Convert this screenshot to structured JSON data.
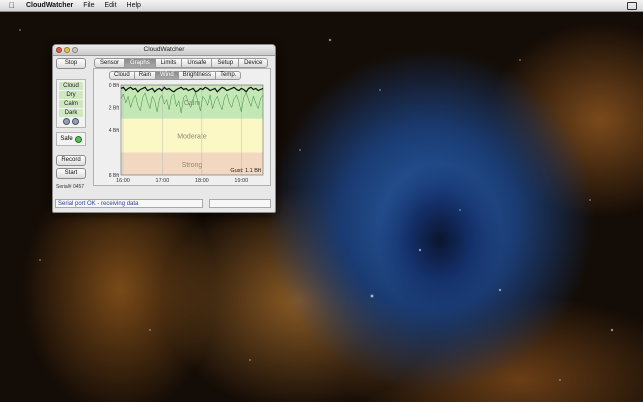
{
  "menubar": {
    "app_name": "CloudWatcher",
    "items": [
      "File",
      "Edit",
      "Help"
    ]
  },
  "window": {
    "title": "CloudWatcher"
  },
  "controls": {
    "stop_label": "Stop",
    "status_items": [
      "Cloud",
      "Dry",
      "Calm",
      "Dark"
    ],
    "safe_label": "Safe",
    "record_label": "Record",
    "start_label": "Start",
    "serial": "Serial# 0457"
  },
  "tabs": {
    "items": [
      "Sensor",
      "Graphs",
      "Limits",
      "Unsafe",
      "Setup",
      "Device"
    ],
    "active": "Graphs"
  },
  "subtabs": {
    "items": [
      "Cloud",
      "Rain",
      "Wind",
      "Brightness",
      "Temp."
    ],
    "active": "Wind"
  },
  "status_message": "Serial port OK - receiving data",
  "chart_data": {
    "type": "line",
    "zones": [
      {
        "name": "Calm",
        "from": 0,
        "to": 3,
        "color": "#c3e8b6"
      },
      {
        "name": "Moderate",
        "from": 3,
        "to": 6,
        "color": "#fbf8c6"
      },
      {
        "name": "Strong",
        "from": 6,
        "to": 8,
        "color": "#f2d8c0"
      }
    ],
    "y_ticks": [
      "0 Bft",
      "2 Bft",
      "4 Bft",
      "8 Bft"
    ],
    "y_tick_values": [
      0,
      2,
      4,
      8
    ],
    "x_ticks": [
      "16:00",
      "17:00",
      "18:00",
      "19:00"
    ],
    "gust_label": "Gust: 1.1 Bft",
    "series": [
      {
        "color": "#111111",
        "values": [
          0.3,
          0.2,
          0.5,
          0.3,
          0.2,
          0.4,
          0.3,
          0.6,
          0.4,
          0.3,
          0.2,
          0.5,
          0.4,
          0.3,
          0.6,
          0.4,
          0.3,
          0.5,
          0.2,
          0.4,
          0.3,
          0.5,
          0.6,
          0.4,
          0.3,
          0.2,
          0.4,
          0.3,
          0.5,
          0.4,
          0.3,
          0.6,
          0.5,
          0.3,
          0.4,
          0.2,
          0.3,
          0.5,
          0.4,
          0.3,
          0.6,
          0.4,
          0.2,
          0.3,
          0.5,
          0.4,
          0.3,
          0.2,
          0.4,
          0.5,
          0.3,
          0.4,
          0.6,
          0.3,
          0.2,
          0.4,
          0.3,
          0.5,
          0.4,
          0.3
        ]
      },
      {
        "color": "#3a8a3a",
        "values": [
          1.2,
          0.8,
          1.6,
          1.0,
          2.0,
          1.3,
          0.9,
          1.8,
          2.3,
          1.1,
          0.7,
          1.5,
          2.1,
          1.0,
          1.4,
          2.4,
          1.2,
          0.9,
          1.7,
          1.3,
          2.2,
          1.0,
          0.8,
          1.9,
          1.4,
          2.5,
          1.1,
          0.9,
          1.6,
          2.0,
          1.2,
          0.7,
          1.5,
          2.3,
          1.0,
          1.3,
          1.8,
          0.9,
          2.1,
          1.4,
          1.0,
          1.7,
          2.2,
          1.1,
          0.8,
          1.6,
          2.0,
          1.2,
          0.9,
          1.5,
          2.4,
          1.1,
          0.7,
          1.3,
          1.9,
          1.0,
          1.6,
          2.1,
          1.2,
          0.9
        ]
      }
    ]
  }
}
